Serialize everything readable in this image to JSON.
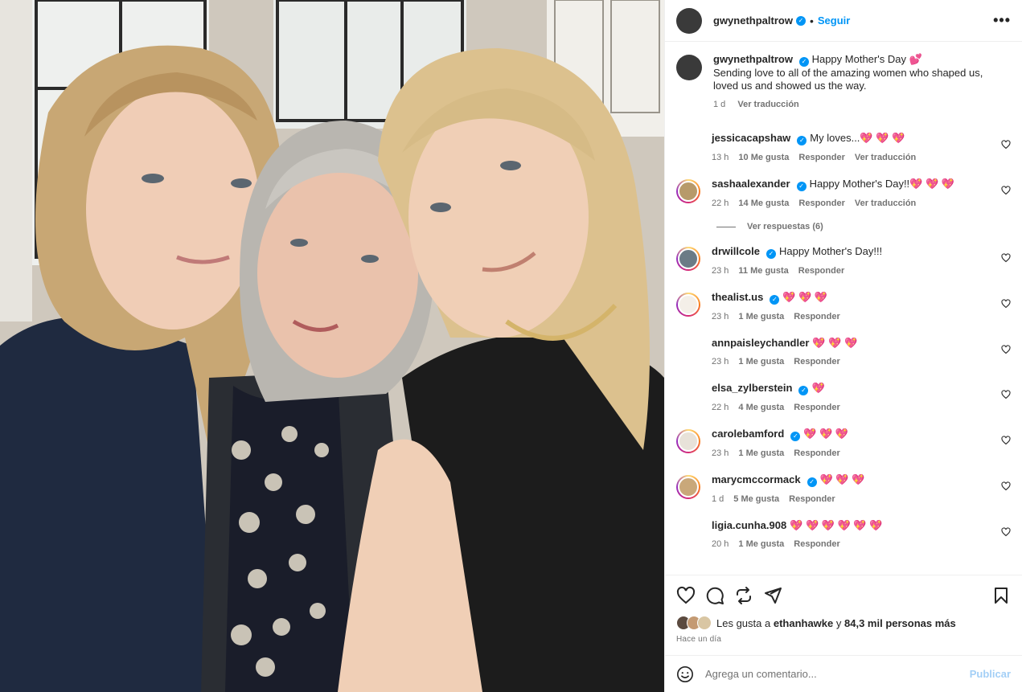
{
  "post": {
    "author": "gwynethpaltrow",
    "follow_label": "Seguir",
    "separator": "•",
    "more_label": "•••",
    "caption_title": "Happy Mother's Day 💕",
    "caption_body": "Sending love to all of the amazing women who shaped us, loved us and showed us the way.",
    "caption_time": "1 d",
    "caption_translate": "Ver traducción"
  },
  "comments": [
    {
      "user": "jessicacapshaw",
      "verified": true,
      "text": "My loves...💖 💖 💖",
      "time": "13 h",
      "likes": "10 Me gusta",
      "reply": "Responder",
      "translate": "Ver traducción",
      "avatar_color": "#d8c8b0",
      "ring": false
    },
    {
      "user": "sashaalexander",
      "verified": true,
      "text": "Happy Mother's Day!!💖 💖 💖",
      "time": "22 h",
      "likes": "14 Me gusta",
      "reply": "Responder",
      "translate": "Ver traducción",
      "avatar_color": "#b79a6a",
      "ring": true
    },
    {
      "user": "drwillcole",
      "verified": true,
      "text": "Happy Mother's Day!!!",
      "time": "23 h",
      "likes": "11 Me gusta",
      "reply": "Responder",
      "translate": "",
      "avatar_color": "#6b7b86",
      "ring": true
    },
    {
      "user": "thealist.us",
      "verified": true,
      "text": "💖 💖 💖",
      "time": "23 h",
      "likes": "1 Me gusta",
      "reply": "Responder",
      "translate": "",
      "avatar_color": "#f4efe8",
      "ring": true
    },
    {
      "user": "annpaisleychandler",
      "verified": false,
      "text": "💖 💖 💖",
      "time": "23 h",
      "likes": "1 Me gusta",
      "reply": "Responder",
      "translate": "",
      "avatar_color": "#8d6e5a",
      "ring": false
    },
    {
      "user": "elsa_zylberstein",
      "verified": true,
      "text": "💖",
      "time": "22 h",
      "likes": "4 Me gusta",
      "reply": "Responder",
      "translate": "",
      "avatar_color": "#5a4035",
      "ring": false
    },
    {
      "user": "carolebamford",
      "verified": true,
      "text": "💖 💖 💖",
      "time": "23 h",
      "likes": "1 Me gusta",
      "reply": "Responder",
      "translate": "",
      "avatar_color": "#e8e2d9",
      "ring": true
    },
    {
      "user": "marycmccormack",
      "verified": true,
      "text": "💖 💖 💖",
      "time": "1 d",
      "likes": "5 Me gusta",
      "reply": "Responder",
      "translate": "",
      "avatar_color": "#c9a87a",
      "ring": true
    },
    {
      "user": "ligia.cunha.908",
      "verified": false,
      "text": "💖 💖 💖 💖 💖 💖",
      "time": "20 h",
      "likes": "1 Me gusta",
      "reply": "Responder",
      "translate": "",
      "avatar_color": "#d6c2a6",
      "ring": false
    }
  ],
  "replies_label": "Ver respuestas (6)",
  "likes": {
    "prefix": "Les gusta a",
    "user": "ethanhawke",
    "connector": "y",
    "count": "84,3 mil personas más"
  },
  "post_age": "Hace un día",
  "comment_box": {
    "placeholder": "Agrega un comentario...",
    "publish_label": "Publicar"
  },
  "colors": {
    "accent": "#0095f6",
    "heart": "#ed4956",
    "secondary_text": "#737373",
    "publish_disabled": "#a3cff6"
  }
}
